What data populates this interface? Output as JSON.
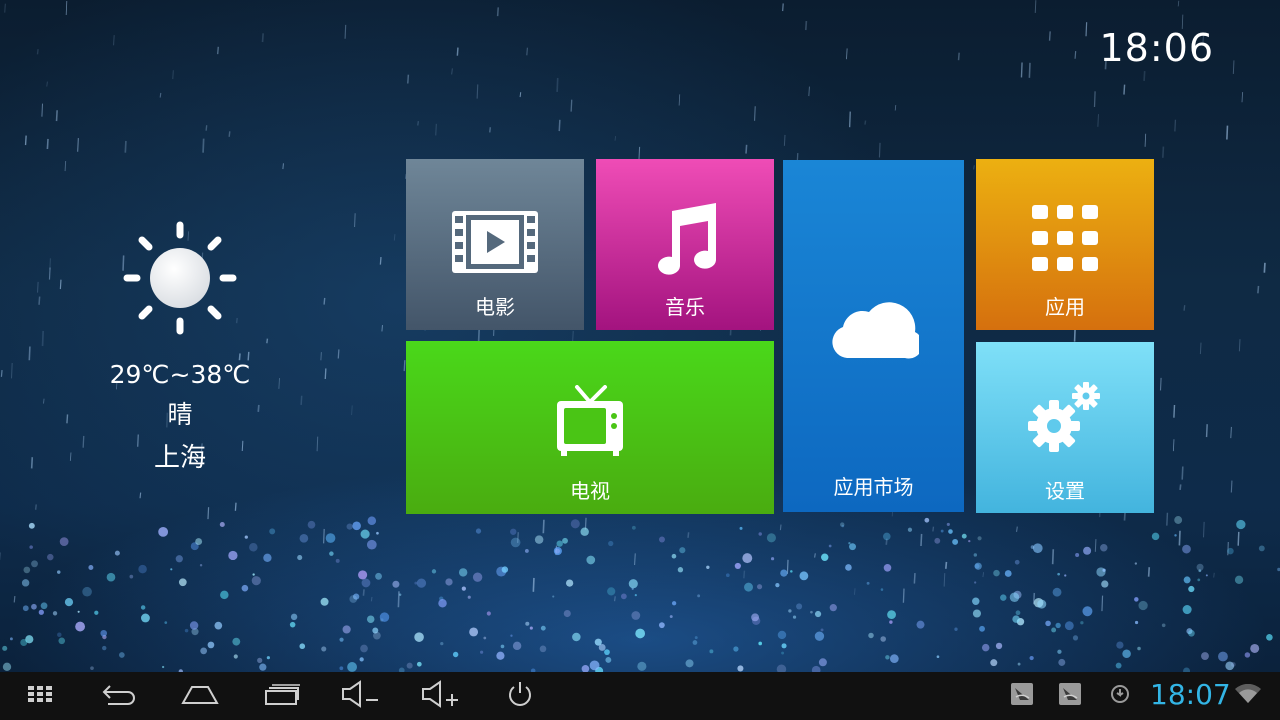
{
  "status": {
    "clock": "18:06"
  },
  "weather": {
    "icon": "sun-icon",
    "temperature": "29℃~38℃",
    "condition": "晴",
    "city": "上海"
  },
  "tiles": {
    "movie": {
      "label": "电影",
      "icon": "film-icon",
      "color": "#5a6f82"
    },
    "music": {
      "label": "音乐",
      "icon": "music-note-icon",
      "color": "#d22f9e"
    },
    "tv": {
      "label": "电视",
      "icon": "tv-icon",
      "color": "#4ac515"
    },
    "store": {
      "label": "应用市场",
      "icon": "cloud-icon",
      "color": "#1277cb"
    },
    "apps": {
      "label": "应用",
      "icon": "app-grid-icon",
      "color": "#e19010"
    },
    "settings": {
      "label": "设置",
      "icon": "gear-icon",
      "color": "#5fcaec"
    }
  },
  "taskbar": {
    "clock": "18:07",
    "clock_color": "#33b5e5",
    "buttons": [
      "app-drawer-icon",
      "back-icon",
      "home-icon",
      "recent-apps-icon",
      "volume-down-icon",
      "volume-up-icon",
      "power-icon"
    ],
    "status_icons": [
      "notification-icon",
      "notification-icon",
      "sync-icon",
      "wifi-icon"
    ]
  }
}
